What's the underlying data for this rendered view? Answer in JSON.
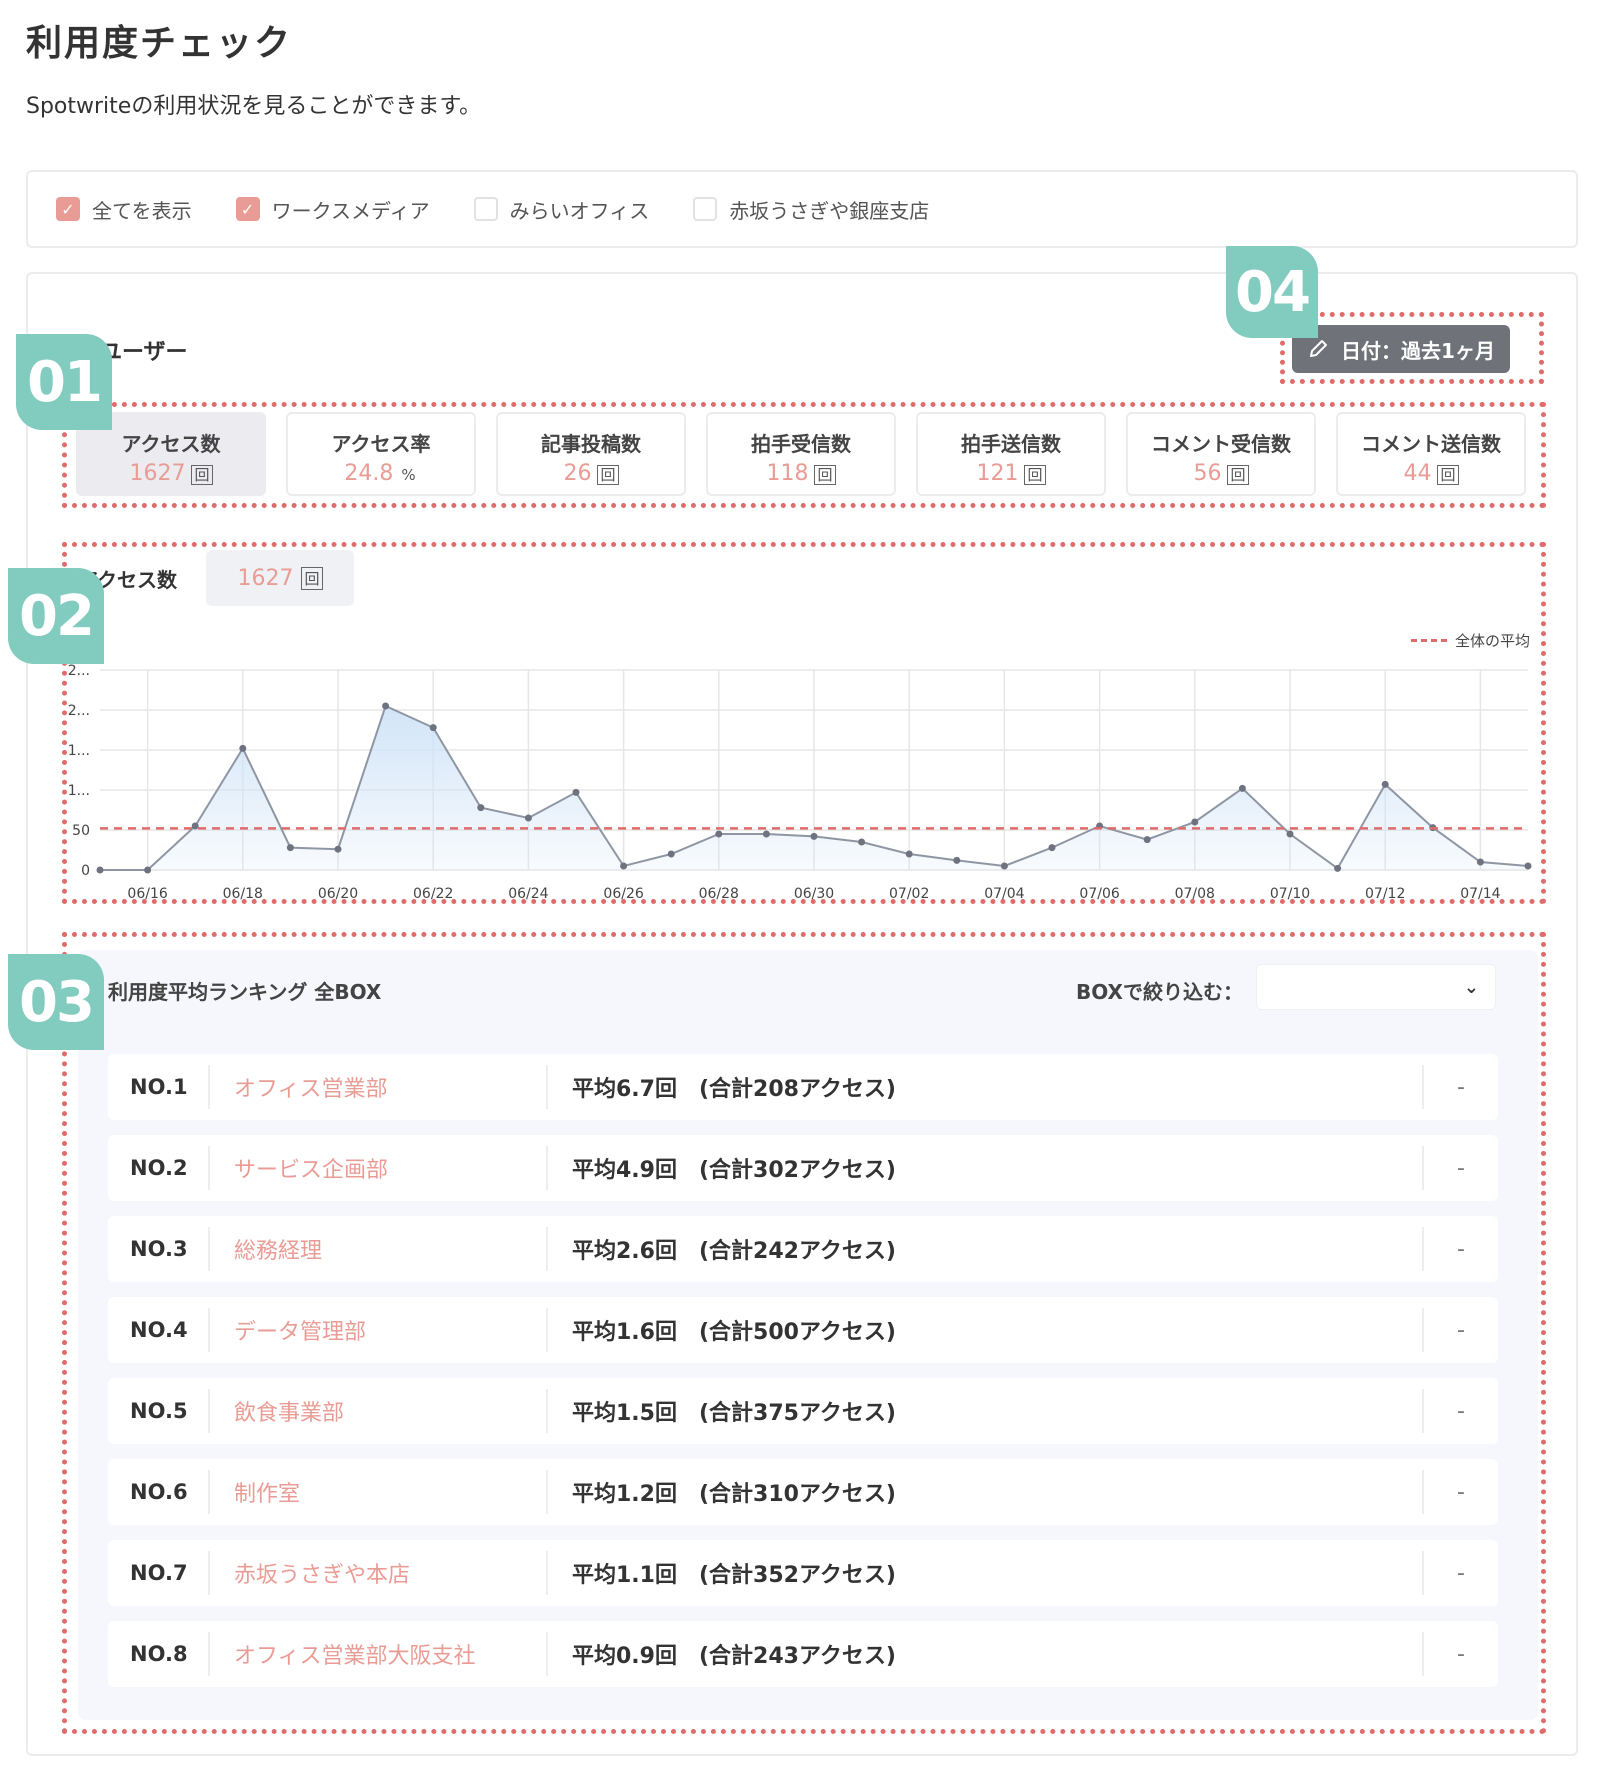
{
  "header": {
    "title": "利用度チェック",
    "description": "Spotwriteの利用状況を見ることができます。"
  },
  "filters": [
    {
      "label": "全てを表示",
      "checked": true
    },
    {
      "label": "ワークスメディア",
      "checked": true
    },
    {
      "label": "みらいオフィス",
      "checked": false
    },
    {
      "label": "赤坂うさぎや銀座支店",
      "checked": false
    }
  ],
  "badges": {
    "b1": "01",
    "b2": "02",
    "b3": "03",
    "b4": "04"
  },
  "section": {
    "title": "ユーザー"
  },
  "date_button": {
    "label": "日付：過去1ヶ月",
    "icon": "pencil-icon"
  },
  "metrics": [
    {
      "label": "アクセス数",
      "value": "1627",
      "unit": "回"
    },
    {
      "label": "アクセス率",
      "value": "24.8",
      "unit": "%"
    },
    {
      "label": "記事投稿数",
      "value": "26",
      "unit": "回"
    },
    {
      "label": "拍手受信数",
      "value": "118",
      "unit": "回"
    },
    {
      "label": "拍手送信数",
      "value": "121",
      "unit": "回"
    },
    {
      "label": "コメント受信数",
      "value": "56",
      "unit": "回"
    },
    {
      "label": "コメント送信数",
      "value": "44",
      "unit": "回"
    }
  ],
  "chart": {
    "title": "アクセス数",
    "total": "1627",
    "unit": "回",
    "legend": "全体の平均"
  },
  "chart_data": {
    "type": "area",
    "x": [
      "06/15",
      "06/16",
      "06/17",
      "06/18",
      "06/19",
      "06/20",
      "06/21",
      "06/22",
      "06/23",
      "06/24",
      "06/25",
      "06/26",
      "06/27",
      "06/28",
      "06/29",
      "06/30",
      "07/01",
      "07/02",
      "07/03",
      "07/04",
      "07/05",
      "07/06",
      "07/07",
      "07/08",
      "07/09",
      "07/10",
      "07/11",
      "07/12",
      "07/13",
      "07/14",
      "07/15"
    ],
    "xticks": [
      "06/16",
      "06/18",
      "06/20",
      "06/22",
      "06/24",
      "06/26",
      "06/28",
      "06/30",
      "07/02",
      "07/04",
      "07/06",
      "07/08",
      "07/10",
      "07/12",
      "07/14"
    ],
    "yticks": [
      "0",
      "50",
      "1...",
      "1...",
      "2...",
      "2..."
    ],
    "values": [
      0,
      0,
      55,
      152,
      28,
      26,
      205,
      178,
      78,
      65,
      97,
      5,
      20,
      45,
      45,
      42,
      35,
      20,
      12,
      5,
      28,
      55,
      38,
      60,
      102,
      45,
      2,
      107,
      53,
      10,
      5
    ],
    "average": 52,
    "ylim": [
      0,
      250
    ],
    "grid": true,
    "legend_position": "top-right"
  },
  "ranking": {
    "title": "利用度平均ランキング 全BOX",
    "filter_label": "BOXで絞り込む：",
    "filter_value": "",
    "rows": [
      {
        "no": "NO.1",
        "name": "オフィス営業部",
        "stat": "平均6.7回　(合計208アクセス)",
        "extra": "-"
      },
      {
        "no": "NO.2",
        "name": "サービス企画部",
        "stat": "平均4.9回　(合計302アクセス)",
        "extra": "-"
      },
      {
        "no": "NO.3",
        "name": "総務経理",
        "stat": "平均2.6回　(合計242アクセス)",
        "extra": "-"
      },
      {
        "no": "NO.4",
        "name": "データ管理部",
        "stat": "平均1.6回　(合計500アクセス)",
        "extra": "-"
      },
      {
        "no": "NO.5",
        "name": "飲食事業部",
        "stat": "平均1.5回　(合計375アクセス)",
        "extra": "-"
      },
      {
        "no": "NO.6",
        "name": "制作室",
        "stat": "平均1.2回　(合計310アクセス)",
        "extra": "-"
      },
      {
        "no": "NO.7",
        "name": "赤坂うさぎや本店",
        "stat": "平均1.1回　(合計352アクセス)",
        "extra": "-"
      },
      {
        "no": "NO.8",
        "name": "オフィス営業部大阪支社",
        "stat": "平均0.9回　(合計243アクセス)",
        "extra": "-"
      }
    ]
  },
  "colors": {
    "accent": "#e99c95",
    "badge": "#82cbbf",
    "dotted": "#e06b6b",
    "line": "#8f96a3",
    "fill": "#cfe3f7"
  }
}
